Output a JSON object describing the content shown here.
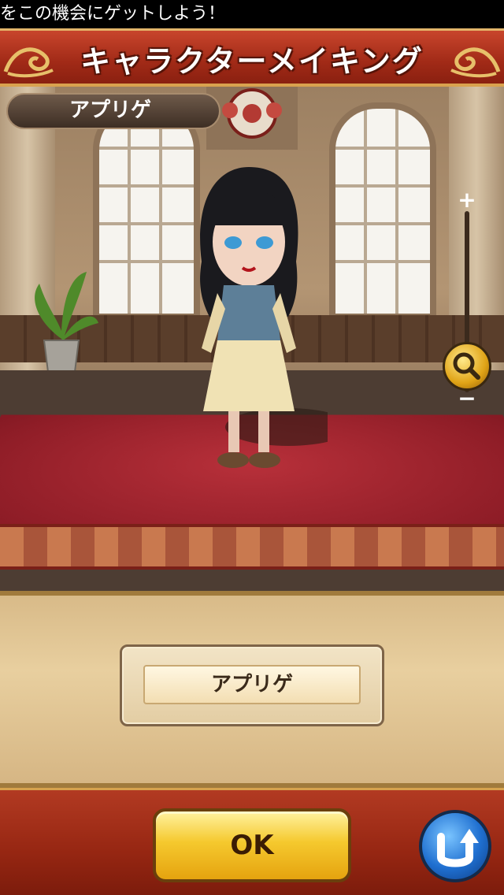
{
  "ticker": {
    "text": "をこの機会にゲットしよう！"
  },
  "header": {
    "title": "キャラクターメイキング"
  },
  "character": {
    "name": "アプリゲ"
  },
  "zoom": {
    "plus_label": "+",
    "minus_label": "−",
    "icon": "magnifier-icon"
  },
  "option": {
    "label": "アプリゲ"
  },
  "footer": {
    "ok_label": "OK",
    "back_icon": "return-arrow-icon"
  },
  "colors": {
    "header_red": "#a12a17",
    "gold": "#f5c92e",
    "blue": "#1f6fd0",
    "panel": "#e8cf9f"
  }
}
